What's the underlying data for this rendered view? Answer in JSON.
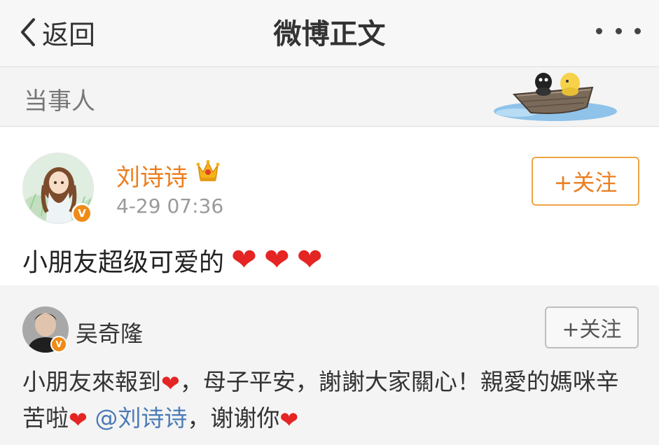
{
  "nav": {
    "back_label": "返回",
    "title": "微博正文",
    "more_icon": "more-dots-icon"
  },
  "section": {
    "label": "当事人",
    "illustration": "boat-illustration"
  },
  "post": {
    "author": "刘诗诗",
    "verified": "V",
    "time": "4-29 07:36",
    "follow_label": "+关注",
    "content": "小朋友超级可爱的",
    "hearts": [
      "❤",
      "❤",
      "❤"
    ],
    "colors": {
      "author": "#eb7e1f",
      "follow_border": "#f0a445",
      "heart": "#e52424"
    }
  },
  "repost": {
    "author": "吴奇隆",
    "verified": "V",
    "follow_label": "+关注",
    "segments": {
      "s1": "小朋友來報到",
      "s2": "，母子平安，謝謝大家關心！親愛的媽咪辛苦啦",
      "s3": "@刘诗诗",
      "s4": "，谢谢你",
      "heart": "❤"
    },
    "colors": {
      "mention": "#4a7bb7"
    }
  }
}
